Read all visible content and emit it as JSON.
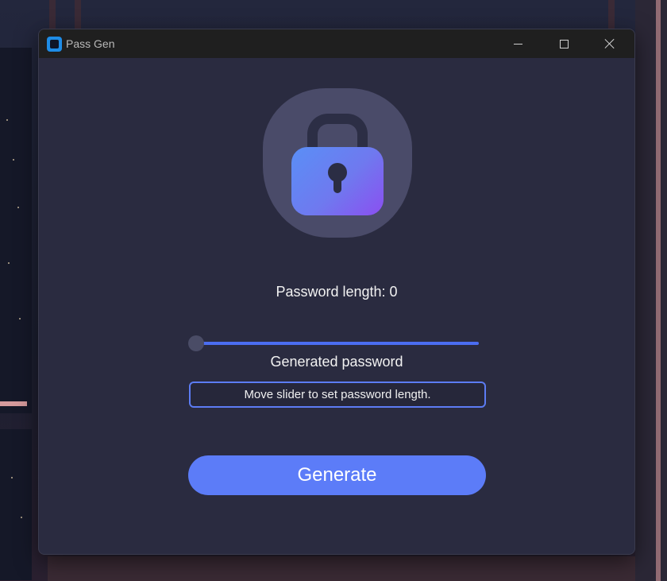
{
  "window": {
    "title": "Pass Gen"
  },
  "icons": {
    "app": "app-icon",
    "lock": "lock-icon",
    "minimize": "minimize-icon",
    "maximize": "maximize-icon",
    "close": "close-icon"
  },
  "main": {
    "length_label": "Password length: 0",
    "slider_value": 0,
    "generated_label": "Generated password",
    "password_field_value": "Move slider to set password length.",
    "generate_button": "Generate"
  },
  "colors": {
    "accent": "#5c7cf8",
    "window_bg": "#2a2b40",
    "titlebar_bg": "#1f1f1f"
  }
}
